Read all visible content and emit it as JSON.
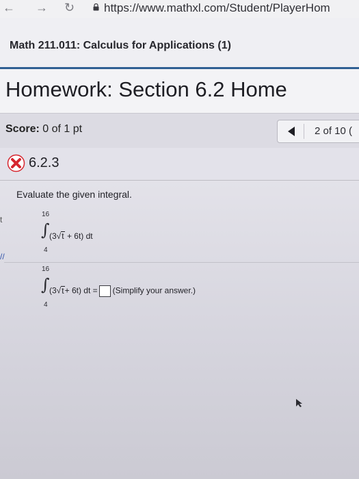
{
  "browser": {
    "url": "https://www.mathxl.com/Student/PlayerHom"
  },
  "course": {
    "title": "Math 211.011: Calculus for Applications (1)"
  },
  "homework": {
    "title": "Homework: Section 6.2 Home"
  },
  "score": {
    "label": "Score:",
    "value": "0 of 1 pt"
  },
  "pager": {
    "text": "2 of 10 ("
  },
  "problem": {
    "id": "6.2.3",
    "status_icon": "x-circle-icon"
  },
  "question": {
    "instruction": "Evaluate the given integral.",
    "upper_limit": "16",
    "lower_limit": "4",
    "integrand_open": "(3",
    "sqrt_arg": "t",
    "integrand_rest": " + 6t) dt",
    "answer_prefix": " dt =",
    "answer_value": "",
    "simplify_hint": "(Simplify your answer.)"
  },
  "colors": {
    "accent": "#2f5f93",
    "error_red": "#d6262f"
  }
}
